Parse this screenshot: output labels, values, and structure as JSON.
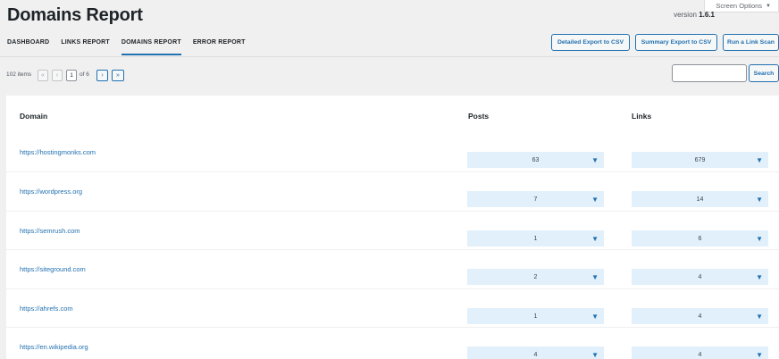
{
  "screen_options": "Screen Options",
  "title": "Domains Report",
  "version_label": "version",
  "version_number": "1.6.1",
  "tabs": [
    {
      "label": "DASHBOARD",
      "active": false
    },
    {
      "label": "LINKS REPORT",
      "active": false
    },
    {
      "label": "DOMAINS REPORT",
      "active": true
    },
    {
      "label": "ERROR REPORT",
      "active": false
    }
  ],
  "actions": {
    "detailed_export": "Detailed Export to CSV",
    "summary_export": "Summary Export to CSV",
    "run_scan": "Run a Link Scan"
  },
  "pagination": {
    "items": "102 items",
    "first": "«",
    "prev": "‹",
    "current": "1",
    "of": "of 6",
    "next": "›",
    "last": "»"
  },
  "search": {
    "button": "Search",
    "placeholder": ""
  },
  "table": {
    "headers": {
      "domain": "Domain",
      "posts": "Posts",
      "links": "Links"
    },
    "rows": [
      {
        "domain": "https://hostingmonks.com",
        "posts": "63",
        "links": "679"
      },
      {
        "domain": "https://wordpress.org",
        "posts": "7",
        "links": "14"
      },
      {
        "domain": "https://semrush.com",
        "posts": "1",
        "links": "6"
      },
      {
        "domain": "https://siteground.com",
        "posts": "2",
        "links": "4"
      },
      {
        "domain": "https://ahrefs.com",
        "posts": "1",
        "links": "4"
      },
      {
        "domain": "https://en.wikipedia.org",
        "posts": "4",
        "links": "4"
      }
    ]
  },
  "icons": {
    "dropdown": "triangle-down-icon"
  },
  "colors": {
    "accent": "#2271b1",
    "select_bg": "#e1f0fb",
    "background": "#f0f0f1"
  }
}
